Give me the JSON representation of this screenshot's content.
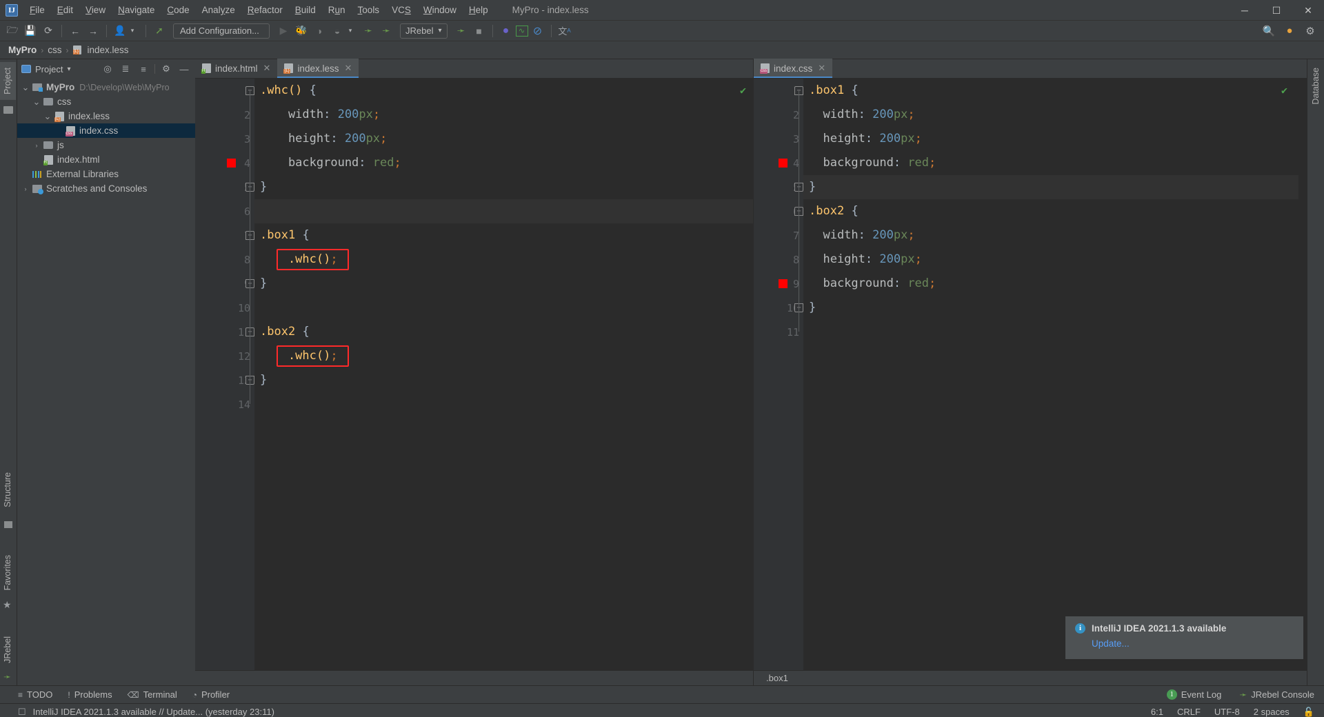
{
  "window": {
    "title": "MyPro - index.less",
    "logo_text": "IJ",
    "controls": {
      "minimize": "─",
      "maximize": "☐",
      "close": "✕"
    }
  },
  "menubar": {
    "items": [
      {
        "label": "File",
        "mnemonic": "F"
      },
      {
        "label": "Edit",
        "mnemonic": "E"
      },
      {
        "label": "View",
        "mnemonic": "V"
      },
      {
        "label": "Navigate",
        "mnemonic": "N"
      },
      {
        "label": "Code",
        "mnemonic": "C"
      },
      {
        "label": "Analyze",
        "mnemonic": "y"
      },
      {
        "label": "Refactor",
        "mnemonic": "R"
      },
      {
        "label": "Build",
        "mnemonic": "B"
      },
      {
        "label": "Run",
        "mnemonic": "u"
      },
      {
        "label": "Tools",
        "mnemonic": "T"
      },
      {
        "label": "VCS",
        "mnemonic": "S"
      },
      {
        "label": "Window",
        "mnemonic": "W"
      },
      {
        "label": "Help",
        "mnemonic": "H"
      }
    ]
  },
  "toolbar": {
    "open_icon": "🗁",
    "save_icon": "💾",
    "sync_icon": "⟳",
    "back_icon": "←",
    "forward_icon": "→",
    "profile_icon": "👤",
    "build_icon": "⬉",
    "add_configuration": "Add Configuration...",
    "run_icon": "▶",
    "debug_icon": "🐞",
    "coverage_icon": "◑",
    "profiler_icon": "◔",
    "jrebel_run_icon": "▶",
    "jrebel_debug_icon": "▶",
    "jrebel_label": "JRebel",
    "jrebel_caret": "▾",
    "stop_icon": "■",
    "browser_icon": "●",
    "chart_icon": "⌗",
    "no_icon": "⊘",
    "translate_icon": "文",
    "search_icon": "🔍",
    "notification_icon": "●",
    "settings_icon": "⚙"
  },
  "breadcrumb": {
    "items": [
      "MyPro",
      "css",
      "index.less"
    ],
    "separator": "›"
  },
  "left_tool_tabs": [
    {
      "label": "Project",
      "icon": "folder-icon",
      "active": true
    },
    {
      "label": "Structure",
      "icon": "structure-icon",
      "active": false
    },
    {
      "label": "Favorites",
      "icon": "star-icon",
      "active": false
    },
    {
      "label": "JRebel",
      "icon": "jrebel-icon",
      "active": false
    }
  ],
  "right_tool_tabs": [
    {
      "label": "Database",
      "icon": "database-icon"
    }
  ],
  "project_panel": {
    "title": "Project",
    "caret": "▾",
    "icons": [
      "locate-icon",
      "expand-all-icon",
      "collapse-all-icon",
      "gear-icon",
      "hide-icon"
    ],
    "tree": [
      {
        "depth": 0,
        "arrow": "⌄",
        "label": "MyPro",
        "bold": true,
        "path": "D:\\Develop\\Web\\MyPro",
        "icon": "module-icon",
        "selected": false
      },
      {
        "depth": 1,
        "arrow": "⌄",
        "label": "css",
        "bold": false,
        "path": "",
        "icon": "folder-icon",
        "selected": false
      },
      {
        "depth": 2,
        "arrow": "⌄",
        "label": "index.less",
        "bold": false,
        "path": "",
        "icon": "less-file-icon",
        "selected": false
      },
      {
        "depth": 3,
        "arrow": "",
        "label": "index.css",
        "bold": false,
        "path": "",
        "icon": "css-file-icon",
        "selected": true
      },
      {
        "depth": 1,
        "arrow": "›",
        "label": "js",
        "bold": false,
        "path": "",
        "icon": "folder-icon",
        "selected": false
      },
      {
        "depth": 1,
        "arrow": "",
        "label": "index.html",
        "bold": false,
        "path": "",
        "icon": "html-file-icon",
        "selected": false
      },
      {
        "depth": 0,
        "arrow": "",
        "label": "External Libraries",
        "bold": false,
        "path": "",
        "icon": "libraries-icon",
        "selected": false
      },
      {
        "depth": 0,
        "arrow": "›",
        "label": "Scratches and Consoles",
        "bold": false,
        "path": "",
        "icon": "scratches-icon",
        "selected": false
      }
    ]
  },
  "editor_left": {
    "tabs": [
      {
        "label": "index.html",
        "icon": "html-file-icon",
        "active": false,
        "close": "✕"
      },
      {
        "label": "index.less",
        "icon": "less-file-icon",
        "active": true,
        "close": "✕"
      }
    ],
    "inspection_status": "✔",
    "lines": [
      {
        "no": "1",
        "segments": [
          {
            "t": ".whc()",
            "c": "tk-sel"
          },
          {
            "t": " ",
            "c": "tk-punc"
          },
          {
            "t": "{",
            "c": "tk-brace"
          }
        ],
        "gutter_mark": false,
        "current": false,
        "fold": "top"
      },
      {
        "no": "2",
        "segments": [
          {
            "t": "    width",
            "c": "tk-propn"
          },
          {
            "t": ": ",
            "c": "tk-punc"
          },
          {
            "t": "200",
            "c": "tk-num"
          },
          {
            "t": "px",
            "c": "tk-unit"
          },
          {
            "t": ";",
            "c": "tk-semi"
          }
        ],
        "gutter_mark": false,
        "current": false,
        "fold": ""
      },
      {
        "no": "3",
        "segments": [
          {
            "t": "    height",
            "c": "tk-propn"
          },
          {
            "t": ": ",
            "c": "tk-punc"
          },
          {
            "t": "200",
            "c": "tk-num"
          },
          {
            "t": "px",
            "c": "tk-unit"
          },
          {
            "t": ";",
            "c": "tk-semi"
          }
        ],
        "gutter_mark": false,
        "current": false,
        "fold": ""
      },
      {
        "no": "4",
        "segments": [
          {
            "t": "    background",
            "c": "tk-propn"
          },
          {
            "t": ": ",
            "c": "tk-punc"
          },
          {
            "t": "red",
            "c": "tk-val"
          },
          {
            "t": ";",
            "c": "tk-semi"
          }
        ],
        "gutter_mark": true,
        "current": false,
        "fold": ""
      },
      {
        "no": "5",
        "segments": [
          {
            "t": "}",
            "c": "tk-brace"
          }
        ],
        "gutter_mark": false,
        "current": false,
        "fold": "bot"
      },
      {
        "no": "6",
        "segments": [],
        "gutter_mark": false,
        "current": true,
        "fold": ""
      },
      {
        "no": "7",
        "segments": [
          {
            "t": ".box1",
            "c": "tk-sel"
          },
          {
            "t": " ",
            "c": "tk-punc"
          },
          {
            "t": "{",
            "c": "tk-brace"
          }
        ],
        "gutter_mark": false,
        "current": false,
        "fold": "top"
      },
      {
        "no": "8",
        "segments": [
          {
            "t": "    .whc()",
            "c": "tk-sel"
          },
          {
            "t": ";",
            "c": "tk-semi"
          }
        ],
        "gutter_mark": false,
        "current": false,
        "fold": "",
        "highlight": true
      },
      {
        "no": "9",
        "segments": [
          {
            "t": "}",
            "c": "tk-brace"
          }
        ],
        "gutter_mark": false,
        "current": false,
        "fold": "bot"
      },
      {
        "no": "10",
        "segments": [],
        "gutter_mark": false,
        "current": false,
        "fold": ""
      },
      {
        "no": "11",
        "segments": [
          {
            "t": ".box2",
            "c": "tk-sel"
          },
          {
            "t": " ",
            "c": "tk-punc"
          },
          {
            "t": "{",
            "c": "tk-brace"
          }
        ],
        "gutter_mark": false,
        "current": false,
        "fold": "top"
      },
      {
        "no": "12",
        "segments": [
          {
            "t": "    .whc()",
            "c": "tk-sel"
          },
          {
            "t": ";",
            "c": "tk-semi"
          }
        ],
        "gutter_mark": false,
        "current": false,
        "fold": "",
        "highlight": true
      },
      {
        "no": "13",
        "segments": [
          {
            "t": "}",
            "c": "tk-brace"
          }
        ],
        "gutter_mark": false,
        "current": false,
        "fold": "bot"
      },
      {
        "no": "14",
        "segments": [],
        "gutter_mark": false,
        "current": false,
        "fold": ""
      }
    ]
  },
  "editor_right": {
    "tabs": [
      {
        "label": "index.css",
        "icon": "css-file-icon",
        "active": true,
        "close": "✕"
      }
    ],
    "inspection_status": "✔",
    "breadcrumb": ".box1",
    "lines": [
      {
        "no": "1",
        "segments": [
          {
            "t": ".box1",
            "c": "tk-sel"
          },
          {
            "t": " ",
            "c": "tk-punc"
          },
          {
            "t": "{",
            "c": "tk-brace"
          }
        ],
        "gutter_mark": false,
        "current": false,
        "fold": "top"
      },
      {
        "no": "2",
        "segments": [
          {
            "t": "  width",
            "c": "tk-propn"
          },
          {
            "t": ": ",
            "c": "tk-punc"
          },
          {
            "t": "200",
            "c": "tk-num"
          },
          {
            "t": "px",
            "c": "tk-unit"
          },
          {
            "t": ";",
            "c": "tk-semi"
          }
        ],
        "gutter_mark": false,
        "current": false,
        "fold": ""
      },
      {
        "no": "3",
        "segments": [
          {
            "t": "  height",
            "c": "tk-propn"
          },
          {
            "t": ": ",
            "c": "tk-punc"
          },
          {
            "t": "200",
            "c": "tk-num"
          },
          {
            "t": "px",
            "c": "tk-unit"
          },
          {
            "t": ";",
            "c": "tk-semi"
          }
        ],
        "gutter_mark": false,
        "current": false,
        "fold": ""
      },
      {
        "no": "4",
        "segments": [
          {
            "t": "  background",
            "c": "tk-propn"
          },
          {
            "t": ": ",
            "c": "tk-punc"
          },
          {
            "t": "red",
            "c": "tk-val"
          },
          {
            "t": ";",
            "c": "tk-semi"
          }
        ],
        "gutter_mark": true,
        "current": false,
        "fold": ""
      },
      {
        "no": "5",
        "segments": [
          {
            "t": "}",
            "c": "tk-brace"
          }
        ],
        "gutter_mark": false,
        "current": true,
        "fold": "bot"
      },
      {
        "no": "6",
        "segments": [
          {
            "t": ".box2",
            "c": "tk-sel"
          },
          {
            "t": " ",
            "c": "tk-punc"
          },
          {
            "t": "{",
            "c": "tk-brace"
          }
        ],
        "gutter_mark": false,
        "current": false,
        "fold": "top"
      },
      {
        "no": "7",
        "segments": [
          {
            "t": "  width",
            "c": "tk-propn"
          },
          {
            "t": ": ",
            "c": "tk-punc"
          },
          {
            "t": "200",
            "c": "tk-num"
          },
          {
            "t": "px",
            "c": "tk-unit"
          },
          {
            "t": ";",
            "c": "tk-semi"
          }
        ],
        "gutter_mark": false,
        "current": false,
        "fold": ""
      },
      {
        "no": "8",
        "segments": [
          {
            "t": "  height",
            "c": "tk-propn"
          },
          {
            "t": ": ",
            "c": "tk-punc"
          },
          {
            "t": "200",
            "c": "tk-num"
          },
          {
            "t": "px",
            "c": "tk-unit"
          },
          {
            "t": ";",
            "c": "tk-semi"
          }
        ],
        "gutter_mark": false,
        "current": false,
        "fold": ""
      },
      {
        "no": "9",
        "segments": [
          {
            "t": "  background",
            "c": "tk-propn"
          },
          {
            "t": ": ",
            "c": "tk-punc"
          },
          {
            "t": "red",
            "c": "tk-val"
          },
          {
            "t": ";",
            "c": "tk-semi"
          }
        ],
        "gutter_mark": true,
        "current": false,
        "fold": ""
      },
      {
        "no": "10",
        "segments": [
          {
            "t": "}",
            "c": "tk-brace"
          }
        ],
        "gutter_mark": false,
        "current": false,
        "fold": "bot"
      },
      {
        "no": "11",
        "segments": [],
        "gutter_mark": false,
        "current": false,
        "fold": ""
      }
    ]
  },
  "notification": {
    "icon": "info-icon",
    "icon_glyph": "i",
    "title": "IntelliJ IDEA 2021.1.3 available",
    "link": "Update..."
  },
  "tool_window_bar": {
    "items": [
      {
        "label": "TODO",
        "icon": "todo-icon",
        "glyph": "≡"
      },
      {
        "label": "Problems",
        "icon": "problems-icon",
        "glyph": "!"
      },
      {
        "label": "Terminal",
        "icon": "terminal-icon",
        "glyph": "⌫"
      },
      {
        "label": "Profiler",
        "icon": "profiler-icon",
        "glyph": "◔"
      }
    ],
    "right": [
      {
        "label": "Event Log",
        "icon": "event-log-icon",
        "badge": "1"
      },
      {
        "label": "JRebel Console",
        "icon": "jrebel-icon",
        "badge": ""
      }
    ]
  },
  "statusbar": {
    "message": "IntelliJ IDEA 2021.1.3 available // Update... (yesterday 23:11)",
    "message_icon": "notification-icon",
    "caret_position": "6:1",
    "line_separator": "CRLF",
    "encoding": "UTF-8",
    "indent": "2 spaces",
    "lock_icon": "🔓"
  },
  "colors": {
    "accent": "#4a88c7",
    "error_marker": "#ff0000",
    "highlight_box": "#ff2a2a",
    "link": "#589df6",
    "ok_check": "#4ea24e"
  }
}
